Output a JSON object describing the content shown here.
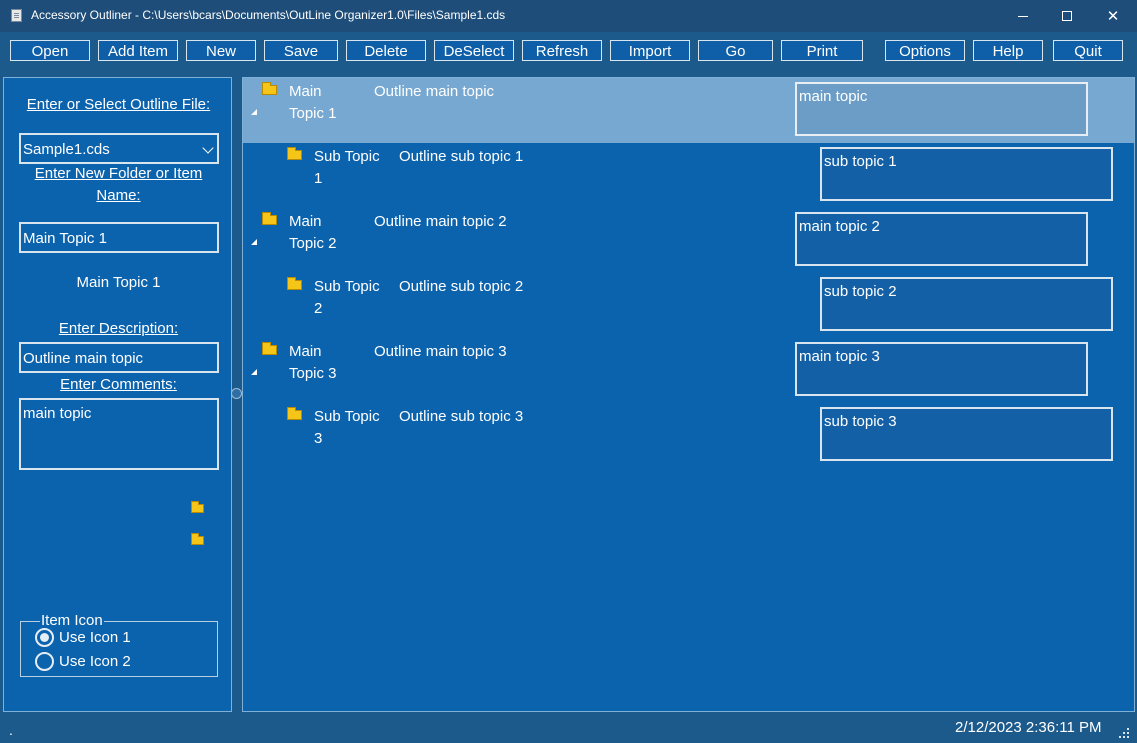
{
  "window": {
    "title": "Accessory Outliner - C:\\Users\\bcars\\Documents\\OutLine Organizer1.0\\Files\\Sample1.cds",
    "minimize_glyph": "",
    "close_glyph": "✕"
  },
  "toolbar": {
    "open": "Open",
    "add_item": "Add Item",
    "new": "New",
    "save": "Save",
    "delete": "Delete",
    "deselect": "DeSelect",
    "refresh": "Refresh",
    "import": "Import",
    "go": "Go",
    "print": "Print",
    "options": "Options",
    "help": "Help",
    "quit": "Quit"
  },
  "left": {
    "file_label": "Enter or Select Outline File:",
    "file_value": "Sample1.cds",
    "new_item_label_1": "Enter New Folder or Item",
    "new_item_label_2": "Name:",
    "name_value": "Main Topic 1",
    "selected_name": "Main Topic 1",
    "description_label": "Enter Description:",
    "description_value": "Outline main topic",
    "comments_label": "Enter Comments:",
    "comments_value": "main topic",
    "item_icon_title": "Item Icon",
    "use_icon_1": "Use Icon 1",
    "use_icon_2": "Use Icon 2",
    "selected_icon_option": "Use Icon 1"
  },
  "tree": {
    "rows": [
      {
        "name1": "Main",
        "name2": "Topic 1",
        "description": "Outline main topic",
        "comment": "main topic",
        "level": 0,
        "selected": true
      },
      {
        "name1": "Sub Topic",
        "name2": "1",
        "description": "Outline sub topic 1",
        "comment": "sub topic 1",
        "level": 1,
        "selected": false
      },
      {
        "name1": "Main",
        "name2": "Topic 2",
        "description": "Outline main topic 2",
        "comment": "main topic 2",
        "level": 0,
        "selected": false
      },
      {
        "name1": "Sub Topic",
        "name2": "2",
        "description": "Outline sub topic 2",
        "comment": "sub topic 2",
        "level": 1,
        "selected": false
      },
      {
        "name1": "Main",
        "name2": "Topic 3",
        "description": "Outline main topic 3",
        "comment": "main topic 3",
        "level": 0,
        "selected": false
      },
      {
        "name1": "Sub Topic",
        "name2": "3",
        "description": "Outline sub topic 3",
        "comment": "sub topic 3",
        "level": 1,
        "selected": false
      }
    ]
  },
  "status": {
    "left_text": ".",
    "datetime": "2/12/2023 2:36:11 PM"
  },
  "colors": {
    "panel_bg": "#0c63ad",
    "frame_bg": "#1c5a8c",
    "selected_row": "#77a8d1",
    "folder": "#f5c518"
  }
}
